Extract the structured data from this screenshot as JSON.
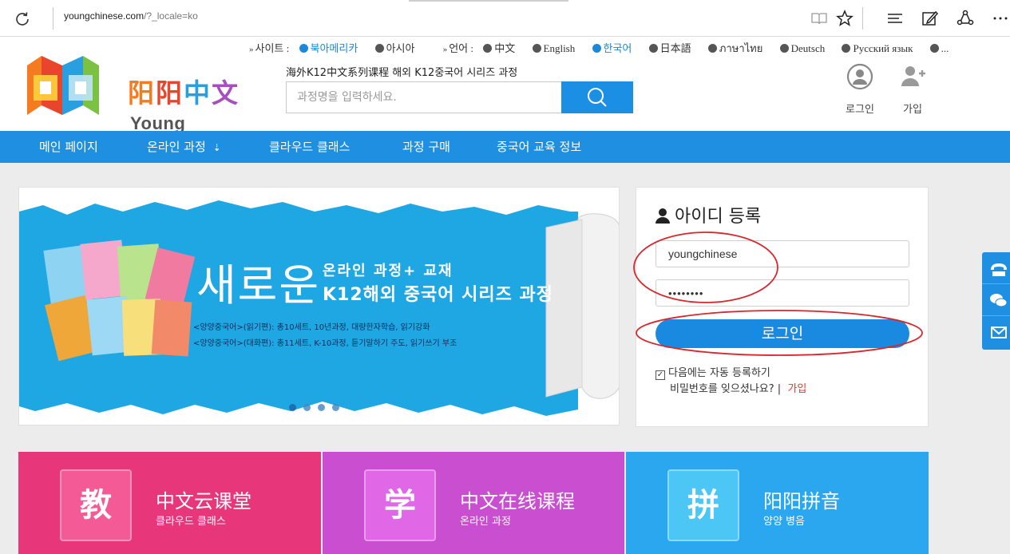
{
  "browser": {
    "url_main": "youngchinese.com",
    "url_path": "/?_locale=ko"
  },
  "header": {
    "site_label": "사이트 :",
    "sites": [
      "북아메리카",
      "아시아"
    ],
    "language_label": "언어 :",
    "languages": [
      "中文",
      "English",
      "한국어",
      "日本語",
      "ภาษาไทย",
      "Deutsch",
      "Русский язык",
      "..."
    ],
    "active_site": "북아메리카",
    "active_language": "한국어",
    "logo_text_zh": "阳阳中文",
    "logo_text_en": "Young Chinese",
    "slogan": "海外K12中文系列课程 해외 K12중국어 시리즈 과정",
    "search_placeholder": "과정명을 입력하세요.",
    "login_label": "로그인",
    "join_label": "가입"
  },
  "nav": {
    "items": [
      "메인 페이지",
      "온라인 과정",
      "클라우드 클래스",
      "과정 구매",
      "중국어 교육 정보"
    ]
  },
  "banner": {
    "headline_big": "새로운",
    "headline_line1": "온라인 과정+ 교재",
    "headline_line2": "K12해외 중국어 시리즈 과정",
    "sub1": "<양양중국어>(읽기편): 총10세트, 10년과정,  대량한자학습,  읽기강화",
    "sub2": "<양양중국어>(대화편): 총11세트, K-10과정, 듣기말하기 주도, 읽기쓰기 부조",
    "slide_count": 4
  },
  "login_panel": {
    "title": "아이디 등록",
    "username_value": "youngchinese",
    "password_value": "••••••••",
    "login_button": "로그인",
    "remember_label": "다음에는 자동 등록하기",
    "forgot_label": "비밀번호를 잊으셨나요?",
    "separator": "|",
    "join_link": "가입"
  },
  "tiles": [
    {
      "badge": "教",
      "zh": "中文云课堂",
      "ko": "클라우드 클래스",
      "color": "#e8367a",
      "badge_color": "#f45a96"
    },
    {
      "badge": "学",
      "zh": "中文在线课程",
      "ko": "온라인 과정",
      "color": "#c94fd0",
      "badge_color": "#e067e6"
    },
    {
      "badge": "拼",
      "zh": "阳阳拼音",
      "ko": "양양 병음",
      "color": "#2aa7ef",
      "badge_color": "#4cc7f5"
    }
  ],
  "colors": {
    "accent": "#1e8fe1",
    "annotation": "#d8262b"
  }
}
